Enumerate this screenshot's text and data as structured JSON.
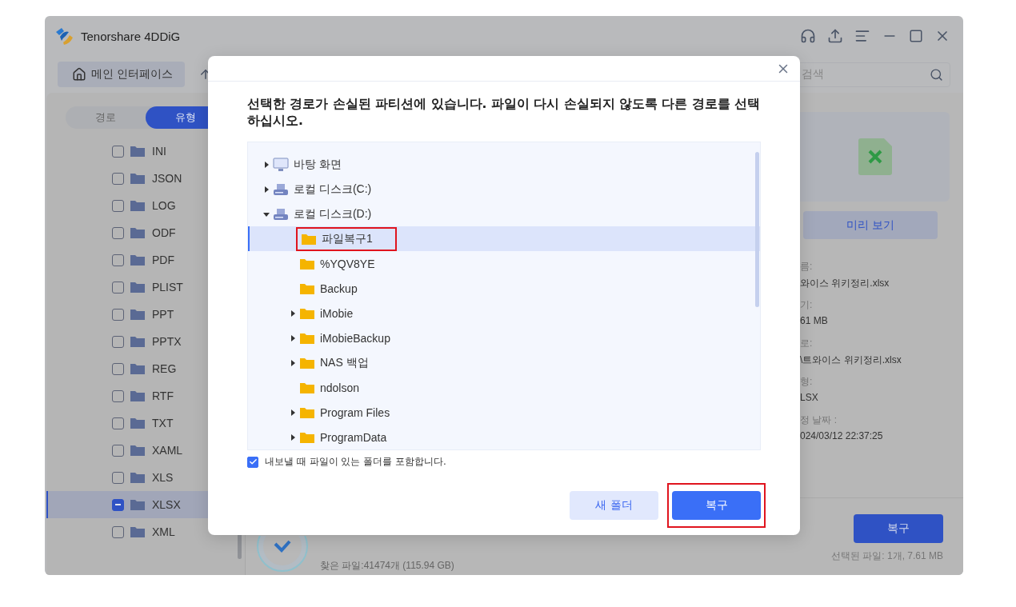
{
  "window": {
    "title": "Tenorshare 4DDiG"
  },
  "toolbar": {
    "home_button": "메인 인터페이스",
    "search": {
      "placeholder": "검색"
    }
  },
  "sidebar": {
    "tabs": [
      {
        "label": "경로",
        "selected": false
      },
      {
        "label": "유형",
        "selected": true
      }
    ],
    "items": [
      {
        "label": "INI",
        "partially_checked": false,
        "selected": false
      },
      {
        "label": "JSON",
        "partially_checked": false,
        "selected": false
      },
      {
        "label": "LOG",
        "partially_checked": false,
        "selected": false
      },
      {
        "label": "ODF",
        "partially_checked": false,
        "selected": false
      },
      {
        "label": "PDF",
        "partially_checked": false,
        "selected": false
      },
      {
        "label": "PLIST",
        "partially_checked": false,
        "selected": false
      },
      {
        "label": "PPT",
        "partially_checked": false,
        "selected": false
      },
      {
        "label": "PPTX",
        "partially_checked": false,
        "selected": false
      },
      {
        "label": "REG",
        "partially_checked": false,
        "selected": false
      },
      {
        "label": "RTF",
        "partially_checked": false,
        "selected": false
      },
      {
        "label": "TXT",
        "partially_checked": false,
        "selected": false
      },
      {
        "label": "XAML",
        "partially_checked": false,
        "selected": false
      },
      {
        "label": "XLS",
        "partially_checked": false,
        "selected": false
      },
      {
        "label": "XLSX",
        "partially_checked": true,
        "selected": true
      },
      {
        "label": "XML",
        "partially_checked": false,
        "selected": false
      }
    ]
  },
  "details": {
    "preview_button": "미리 보기",
    "fields": [
      {
        "label": "름:",
        "value": "와이스 위키정리.xlsx"
      },
      {
        "label": "기:",
        "value": "61 MB"
      },
      {
        "label": "로:",
        "value": "\\트와이스 위키정리.xlsx"
      },
      {
        "label": "형:",
        "value": "LSX"
      },
      {
        "label": "정 날짜 :",
        "value": "024/03/12 22:37:25"
      }
    ]
  },
  "status_bar": {
    "found": "찾은 파일:41474개 (115.94 GB)",
    "recover_button": "복구",
    "selected_info": "선택된 파일: 1개, 7.61 MB"
  },
  "dialog": {
    "message": "선택한 경로가 손실된 파티션에 있습니다. 파일이 다시 손실되지 않도록 다른 경로를 선택하십시오.",
    "tree": [
      {
        "label": "바탕 화면",
        "kind": "desktop",
        "expandable": true,
        "expanded": false,
        "selected": false,
        "highlighted": false
      },
      {
        "label": "로컬 디스크(C:)",
        "kind": "drive",
        "expandable": true,
        "expanded": false,
        "selected": false,
        "highlighted": false
      },
      {
        "label": "로컬 디스크(D:)",
        "kind": "drive",
        "expandable": true,
        "expanded": true,
        "selected": false,
        "highlighted": false,
        "children": [
          {
            "label": "파일복구1",
            "kind": "folder",
            "expandable": false,
            "expanded": false,
            "selected": true,
            "highlighted": true
          },
          {
            "label": "%YQV8YE",
            "kind": "folder",
            "expandable": false,
            "expanded": false,
            "selected": false,
            "highlighted": false
          },
          {
            "label": "Backup",
            "kind": "folder",
            "expandable": false,
            "expanded": false,
            "selected": false,
            "highlighted": false
          },
          {
            "label": "iMobie",
            "kind": "folder",
            "expandable": true,
            "expanded": false,
            "selected": false,
            "highlighted": false
          },
          {
            "label": "iMobieBackup",
            "kind": "folder",
            "expandable": true,
            "expanded": false,
            "selected": false,
            "highlighted": false
          },
          {
            "label": "NAS 백업",
            "kind": "folder",
            "expandable": true,
            "expanded": false,
            "selected": false,
            "highlighted": false
          },
          {
            "label": "ndolson",
            "kind": "folder",
            "expandable": false,
            "expanded": false,
            "selected": false,
            "highlighted": false
          },
          {
            "label": "Program Files",
            "kind": "folder",
            "expandable": true,
            "expanded": false,
            "selected": false,
            "highlighted": false
          },
          {
            "label": "ProgramData",
            "kind": "folder",
            "expandable": true,
            "expanded": false,
            "selected": false,
            "highlighted": false
          }
        ]
      }
    ],
    "include_folders": {
      "label": "내보낼 때 파일이 있는 폴더를 포함합니다.",
      "checked": true
    },
    "buttons": [
      {
        "label": "새 폴더",
        "kind": "secondary"
      },
      {
        "label": "복구",
        "kind": "primary",
        "highlighted": true
      }
    ]
  }
}
